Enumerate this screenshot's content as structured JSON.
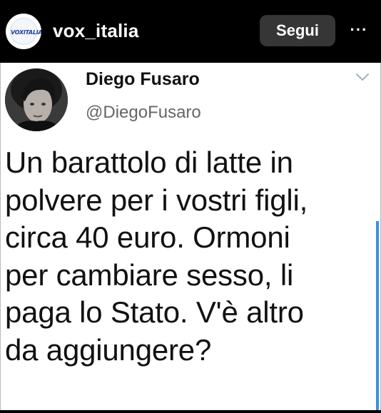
{
  "header": {
    "account_logo_text": "VOXITALIA",
    "username": "vox_italia",
    "follow_label": "Segui",
    "more_label": "···",
    "background_color": "#000000"
  },
  "tweet": {
    "author_name": "Diego Fusaro",
    "author_handle": "@DiegoFusaro",
    "text": "Un barattolo di latte in\npolvere per i vostri figli,\ncirca 40 euro. Ormoni\nper cambiare sesso, li\npaga lo Stato. V'è altro\nda aggiungere?",
    "menu_icon": "chevron-down-icon",
    "scrollbar_color": "#3b8fe0"
  }
}
